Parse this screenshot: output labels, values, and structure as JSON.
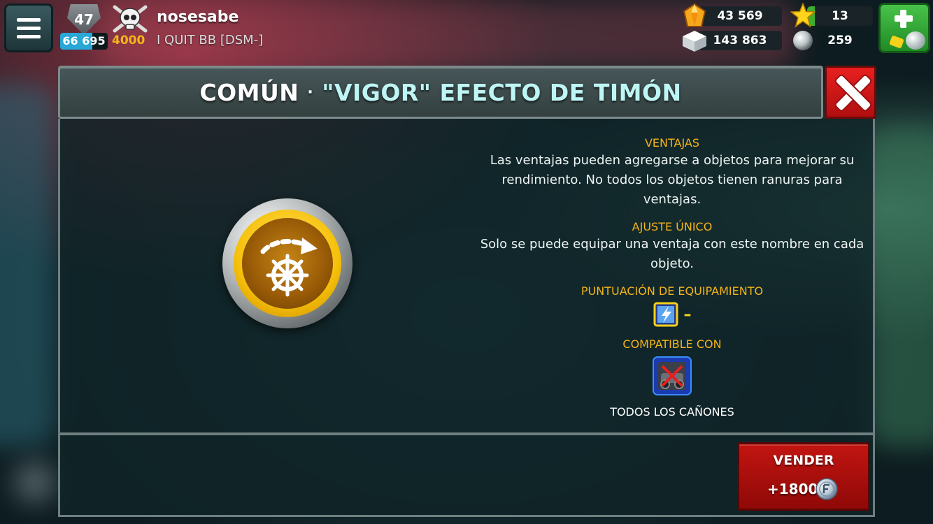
{
  "hud": {
    "level": "47",
    "level_xp": "66 695",
    "level_xp_fraction": 0.68,
    "skull_value": "4000",
    "player_name": "nosesabe",
    "crew_name": "I QUIT BB [DSM-]",
    "gems": "43 569",
    "cubes": "143 863",
    "stars": "13",
    "stars_fraction": 0.12,
    "pearls": "259"
  },
  "dialog": {
    "rarity": "COMÚN",
    "separator": "·",
    "item_name": "\"VIGOR\" EFECTO DE TIMÓN",
    "perks_label": "VENTAJAS",
    "perks_desc": "Las ventajas pueden agregarse a objetos para mejorar su rendimiento. No todos los objetos tienen ranuras para ventajas.",
    "unique_label": "AJUSTE ÚNICO",
    "unique_desc": "Solo se puede equipar una ventaja con este nombre en cada objeto.",
    "score_label": "PUNTUACIÓN DE EQUIPAMIENTO",
    "score_value": "–",
    "compatible_label": "COMPATIBLE CON",
    "compatible_item": "TODOS LOS CAÑONES",
    "sell_label": "VENDER",
    "sell_value": "+1800"
  },
  "colors": {
    "gold_label": "#f4b41a",
    "item_name": "#bdf6f4",
    "sell_red": "#c21511",
    "close_red": "#e8201f",
    "add_green": "#48c34a",
    "xp_blue": "#29a8d8"
  },
  "icons": {
    "menu": "hamburger-icon",
    "level": "level-shield-icon",
    "skull": "skull-icon",
    "gems": "gem-icon",
    "cubes": "cube-icon",
    "stars": "star-icon",
    "pearls": "pearl-icon",
    "add": "plus-icon",
    "close": "close-icon",
    "perk": "helm-wheel-perk-icon",
    "score": "lightning-score-icon",
    "compatible": "cannon-icon",
    "sell": "coin-icon"
  }
}
